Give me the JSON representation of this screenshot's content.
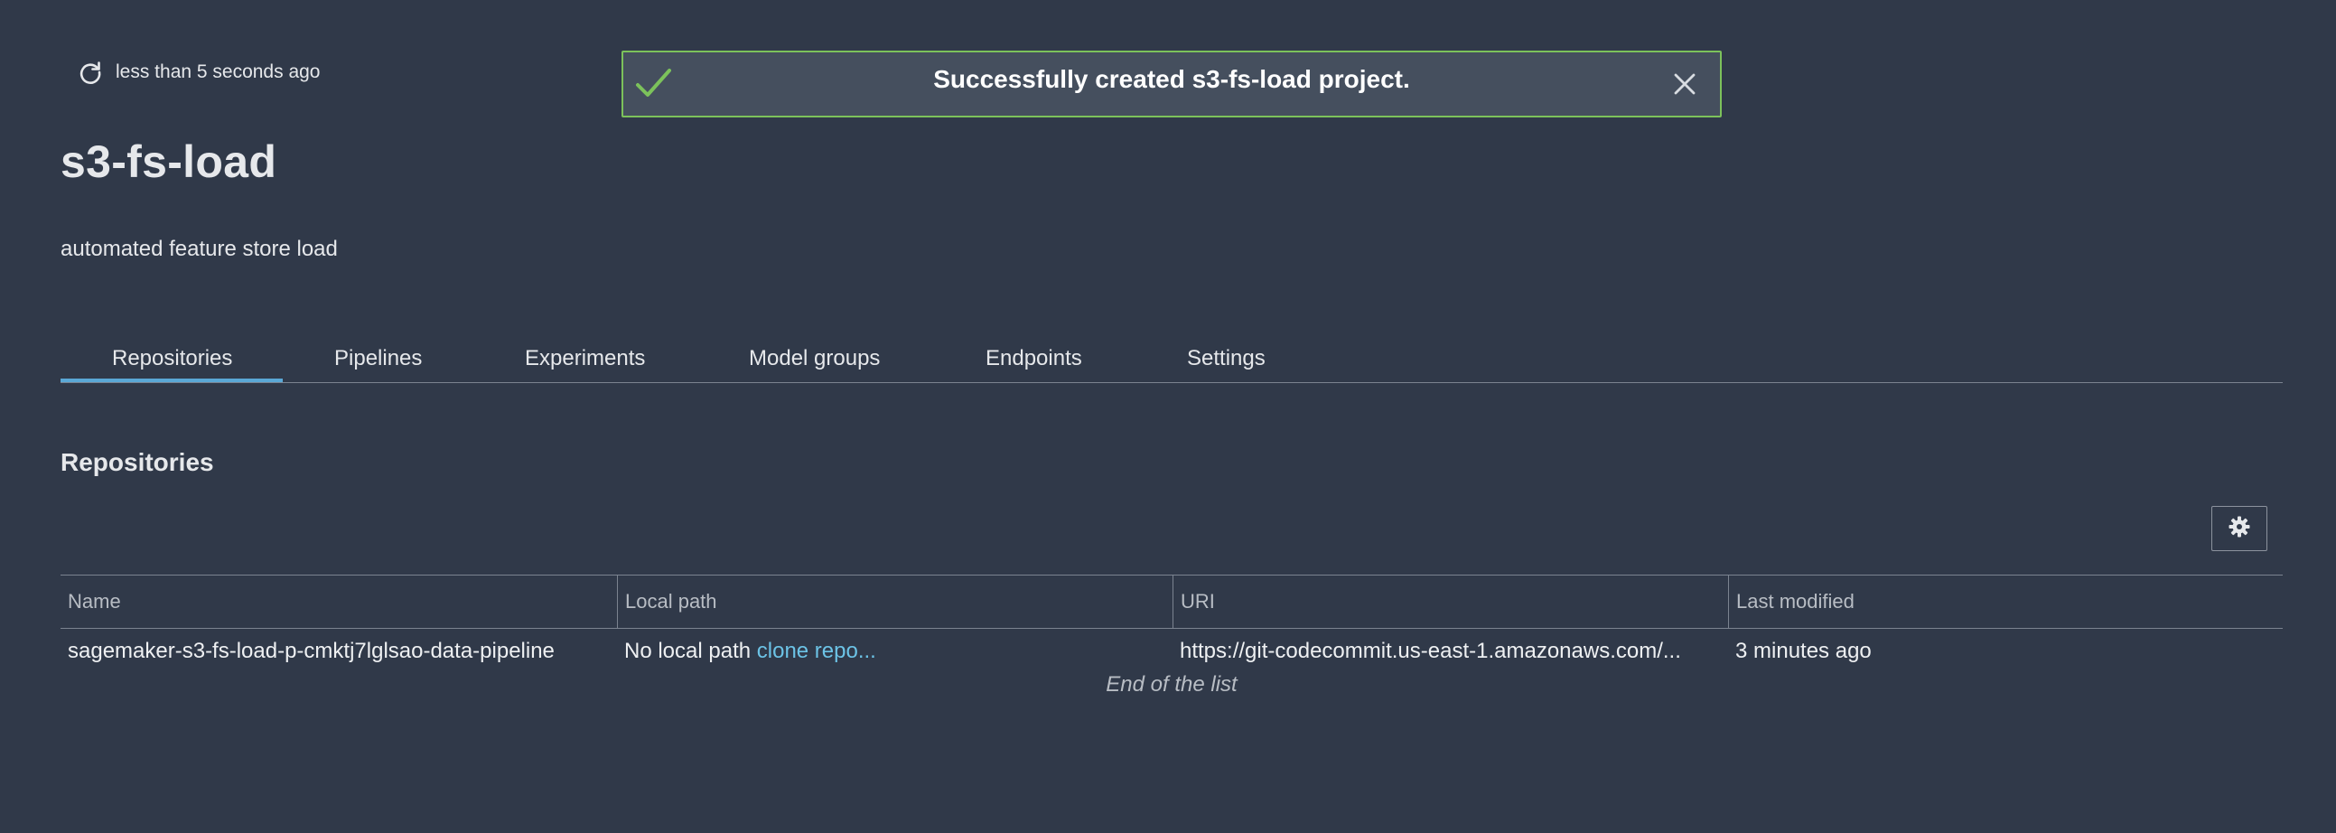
{
  "header": {
    "refresh_label": "less than 5 seconds ago"
  },
  "banner": {
    "message": "Successfully created s3-fs-load project.",
    "accent_color": "#7cc25b"
  },
  "project": {
    "title": "s3-fs-load",
    "description": "automated feature store load"
  },
  "tabs": [
    {
      "label": "Repositories",
      "active": true
    },
    {
      "label": "Pipelines"
    },
    {
      "label": "Experiments"
    },
    {
      "label": "Model groups"
    },
    {
      "label": "Endpoints"
    },
    {
      "label": "Settings"
    }
  ],
  "repositories": {
    "heading": "Repositories",
    "columns": [
      "Name",
      "Local path",
      "URI",
      "Last modified"
    ],
    "rows": [
      {
        "name": "sagemaker-s3-fs-load-p-cmktj7lglsao-data-pipeline",
        "local_path_text": "No local path",
        "local_path_link": "clone repo...",
        "uri": "https://git-codecommit.us-east-1.amazonaws.com/...",
        "last_modified": "3 minutes ago"
      }
    ],
    "end_of_list": "End of the list"
  },
  "icons": {
    "refresh": "refresh-icon",
    "check": "check-icon",
    "close": "close-icon",
    "settings": "gear-icon"
  },
  "colors": {
    "background": "#303949",
    "link": "#6cc3e6",
    "tab_active": "#5aa8d6"
  }
}
